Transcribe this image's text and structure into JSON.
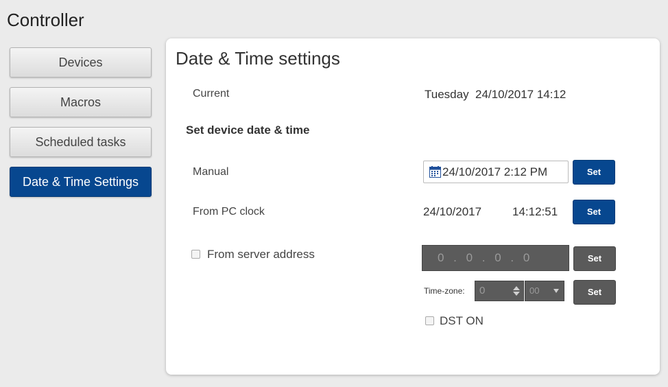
{
  "app": {
    "title": "Controller"
  },
  "nav": {
    "items": [
      {
        "label": "Devices",
        "active": false
      },
      {
        "label": "Macros",
        "active": false
      },
      {
        "label": "Scheduled tasks",
        "active": false
      },
      {
        "label": "Date & Time Settings",
        "active": true
      }
    ]
  },
  "panel": {
    "title": "Date & Time settings",
    "current_label": "Current",
    "current_value": "Tuesday  24/10/2017 14:12",
    "section_title": "Set device date & time",
    "manual": {
      "label": "Manual",
      "value": "24/10/2017 2:12 PM",
      "icon": "calendar-icon",
      "set_label": "Set"
    },
    "pc_clock": {
      "label": "From PC clock",
      "date": "24/10/2017",
      "time": "14:12:51",
      "set_label": "Set"
    },
    "server": {
      "label": "From server address",
      "checked": false,
      "ip": "0 . 0 . 0 . 0",
      "set_label": "Set"
    },
    "timezone": {
      "label": "Time-zone:",
      "hours": "0",
      "minutes": "00",
      "set_label": "Set"
    },
    "dst": {
      "label": "DST ON",
      "checked": false
    }
  },
  "colors": {
    "accent": "#07478f",
    "disabled_field": "#5b5b5b",
    "background": "#ebebeb"
  }
}
